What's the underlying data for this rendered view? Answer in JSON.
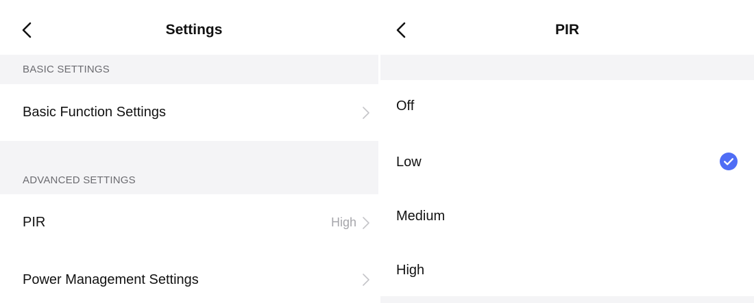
{
  "settings_screen": {
    "title": "Settings",
    "sections": [
      {
        "header": "BASIC SETTINGS",
        "items": [
          {
            "label": "Basic Function Settings",
            "value": ""
          }
        ]
      },
      {
        "header": "ADVANCED SETTINGS",
        "items": [
          {
            "label": "PIR",
            "value": "High"
          },
          {
            "label": "Power Management Settings",
            "value": ""
          }
        ]
      }
    ]
  },
  "pir_screen": {
    "title": "PIR",
    "options": [
      {
        "label": "Off",
        "selected": false
      },
      {
        "label": "Low",
        "selected": true
      },
      {
        "label": "Medium",
        "selected": false
      },
      {
        "label": "High",
        "selected": false
      }
    ]
  },
  "colors": {
    "accent": "#4f6df5",
    "group_background": "#f4f4f6",
    "secondary_text": "#a6a6ab",
    "header_text": "#6b6b70"
  },
  "icons": {
    "back": "chevron-left-icon",
    "disclosure": "chevron-right-icon",
    "selected": "check-circle-icon"
  }
}
